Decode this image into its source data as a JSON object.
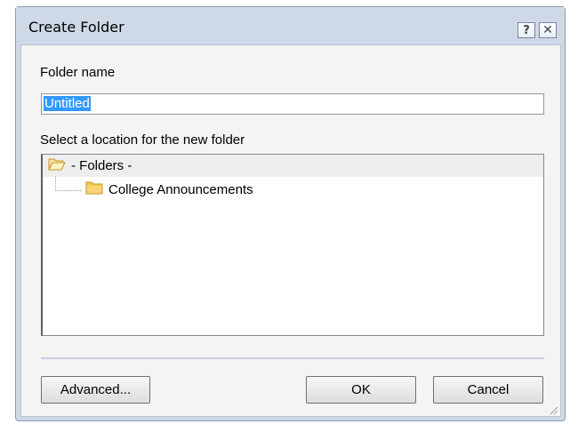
{
  "window": {
    "title": "Create Folder",
    "help_label": "?",
    "close_label": "✕"
  },
  "form": {
    "folder_name_label": "Folder name",
    "folder_name_value": "Untitled",
    "location_label": "Select a location for the new folder"
  },
  "tree": {
    "root_label": "- Folders -",
    "items": [
      {
        "label": "College Announcements"
      }
    ]
  },
  "buttons": {
    "advanced": "Advanced...",
    "ok": "OK",
    "cancel": "Cancel"
  },
  "icons": {
    "root": "open-folder-icon",
    "item": "folder-icon"
  },
  "colors": {
    "selection": "#3399ff",
    "folder": "#f3c64d",
    "title_bar": "#cfd8e6"
  }
}
